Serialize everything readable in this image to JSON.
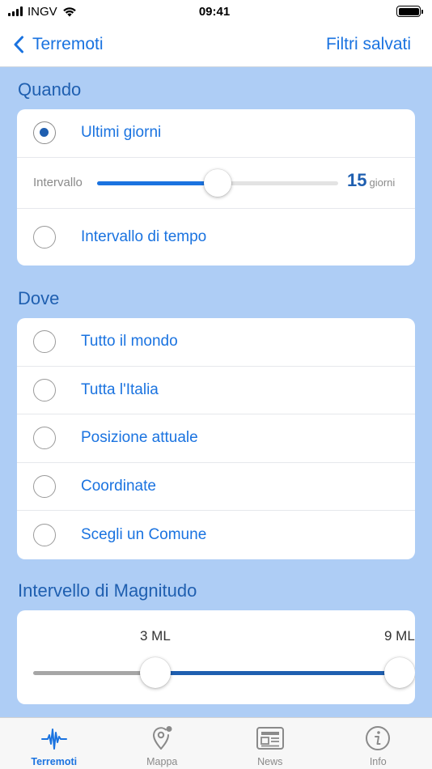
{
  "status_bar": {
    "carrier": "INGV",
    "time": "09:41"
  },
  "nav": {
    "back_label": "Terremoti",
    "right_label": "Filtri salvati"
  },
  "quando": {
    "title": "Quando",
    "options": [
      {
        "label": "Ultimi giorni",
        "checked": true
      },
      {
        "label": "Intervallo di tempo",
        "checked": false
      }
    ],
    "interval": {
      "label": "Intervallo",
      "value": "15",
      "unit": "giorni",
      "slider_fraction": 0.5
    }
  },
  "dove": {
    "title": "Dove",
    "options": [
      {
        "label": "Tutto il mondo",
        "checked": false
      },
      {
        "label": "Tutta l'Italia",
        "checked": false
      },
      {
        "label": "Posizione attuale",
        "checked": false
      },
      {
        "label": "Coordinate",
        "checked": false
      },
      {
        "label": "Scegli un Comune",
        "checked": false
      }
    ]
  },
  "magnitudo": {
    "title": "Intervello di Magnitudo",
    "min_label": "3 ML",
    "max_label": "9 ML",
    "min_value": 3,
    "max_value": 9,
    "range": [
      0,
      9
    ]
  },
  "tabs": [
    {
      "label": "Terremoti",
      "icon": "seismograph-icon",
      "active": true
    },
    {
      "label": "Mappa",
      "icon": "map-pin-icon",
      "active": false
    },
    {
      "label": "News",
      "icon": "newspaper-icon",
      "active": false
    },
    {
      "label": "Info",
      "icon": "info-icon",
      "active": false
    }
  ],
  "colors": {
    "accent": "#1a73e0",
    "section": "#1f5fb0",
    "background": "#aecdf5"
  }
}
